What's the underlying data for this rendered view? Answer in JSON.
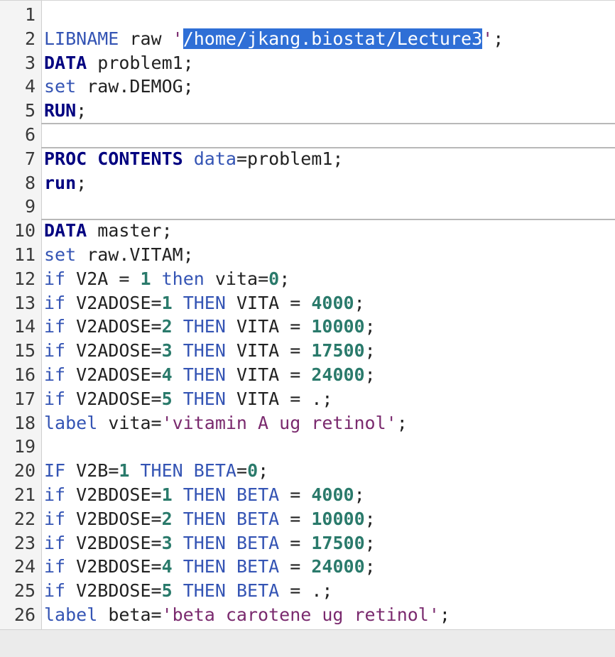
{
  "editor": {
    "selection_color": "#2f6fd6",
    "line_numbers": [
      "1",
      "2",
      "3",
      "4",
      "5",
      "6",
      "7",
      "8",
      "9",
      "10",
      "11",
      "12",
      "13",
      "14",
      "15",
      "16",
      "17",
      "18",
      "19",
      "20",
      "21",
      "22",
      "23",
      "24",
      "25",
      "26"
    ]
  },
  "code": [
    {
      "tokens": [],
      "sep": false
    },
    {
      "tokens": [
        {
          "t": "LIBNAME",
          "c": "st"
        },
        {
          "t": " raw ",
          "c": "txt"
        },
        {
          "t": "'",
          "c": "str"
        },
        {
          "t": "/home/jkang.biostat/Lecture3",
          "c": "sel"
        },
        {
          "t": "'",
          "c": "str"
        },
        {
          "t": ";",
          "c": "txt"
        }
      ],
      "sep": false
    },
    {
      "tokens": [
        {
          "t": "DATA",
          "c": "kw"
        },
        {
          "t": " problem1;",
          "c": "txt"
        }
      ],
      "sep": false
    },
    {
      "tokens": [
        {
          "t": "set",
          "c": "st"
        },
        {
          "t": " raw.DEMOG;",
          "c": "txt"
        }
      ],
      "sep": false
    },
    {
      "tokens": [
        {
          "t": "RUN",
          "c": "kw"
        },
        {
          "t": ";",
          "c": "txt"
        }
      ],
      "sep": false
    },
    {
      "tokens": [],
      "sep": true
    },
    {
      "tokens": [
        {
          "t": "PROC CONTENTS",
          "c": "kw"
        },
        {
          "t": " ",
          "c": "txt"
        },
        {
          "t": "data",
          "c": "st"
        },
        {
          "t": "=problem1;",
          "c": "txt"
        }
      ],
      "sep": true
    },
    {
      "tokens": [
        {
          "t": "run",
          "c": "kw"
        },
        {
          "t": ";",
          "c": "txt"
        }
      ],
      "sep": false
    },
    {
      "tokens": [],
      "sep": false
    },
    {
      "tokens": [
        {
          "t": "DATA",
          "c": "kw"
        },
        {
          "t": " master;",
          "c": "txt"
        }
      ],
      "sep": true
    },
    {
      "tokens": [
        {
          "t": "set",
          "c": "st"
        },
        {
          "t": " raw.VITAM;",
          "c": "txt"
        }
      ],
      "sep": false
    },
    {
      "tokens": [
        {
          "t": "if",
          "c": "st"
        },
        {
          "t": " V2A = ",
          "c": "txt"
        },
        {
          "t": "1",
          "c": "num"
        },
        {
          "t": " ",
          "c": "txt"
        },
        {
          "t": "then",
          "c": "st"
        },
        {
          "t": " vita=",
          "c": "txt"
        },
        {
          "t": "0",
          "c": "num"
        },
        {
          "t": ";",
          "c": "txt"
        }
      ],
      "sep": false
    },
    {
      "tokens": [
        {
          "t": "if",
          "c": "st"
        },
        {
          "t": " V2ADOSE=",
          "c": "txt"
        },
        {
          "t": "1",
          "c": "num"
        },
        {
          "t": " ",
          "c": "txt"
        },
        {
          "t": "THEN",
          "c": "st"
        },
        {
          "t": " VITA = ",
          "c": "txt"
        },
        {
          "t": "4000",
          "c": "num"
        },
        {
          "t": ";",
          "c": "txt"
        }
      ],
      "sep": false
    },
    {
      "tokens": [
        {
          "t": "if",
          "c": "st"
        },
        {
          "t": " V2ADOSE=",
          "c": "txt"
        },
        {
          "t": "2",
          "c": "num"
        },
        {
          "t": " ",
          "c": "txt"
        },
        {
          "t": "THEN",
          "c": "st"
        },
        {
          "t": " VITA = ",
          "c": "txt"
        },
        {
          "t": "10000",
          "c": "num"
        },
        {
          "t": ";",
          "c": "txt"
        }
      ],
      "sep": false
    },
    {
      "tokens": [
        {
          "t": "if",
          "c": "st"
        },
        {
          "t": " V2ADOSE=",
          "c": "txt"
        },
        {
          "t": "3",
          "c": "num"
        },
        {
          "t": " ",
          "c": "txt"
        },
        {
          "t": "THEN",
          "c": "st"
        },
        {
          "t": " VITA = ",
          "c": "txt"
        },
        {
          "t": "17500",
          "c": "num"
        },
        {
          "t": ";",
          "c": "txt"
        }
      ],
      "sep": false
    },
    {
      "tokens": [
        {
          "t": "if",
          "c": "st"
        },
        {
          "t": " V2ADOSE=",
          "c": "txt"
        },
        {
          "t": "4",
          "c": "num"
        },
        {
          "t": " ",
          "c": "txt"
        },
        {
          "t": "THEN",
          "c": "st"
        },
        {
          "t": " VITA = ",
          "c": "txt"
        },
        {
          "t": "24000",
          "c": "num"
        },
        {
          "t": ";",
          "c": "txt"
        }
      ],
      "sep": false
    },
    {
      "tokens": [
        {
          "t": "if",
          "c": "st"
        },
        {
          "t": " V2ADOSE=",
          "c": "txt"
        },
        {
          "t": "5",
          "c": "num"
        },
        {
          "t": " ",
          "c": "txt"
        },
        {
          "t": "THEN",
          "c": "st"
        },
        {
          "t": " VITA = .;",
          "c": "txt"
        }
      ],
      "sep": false
    },
    {
      "tokens": [
        {
          "t": "label",
          "c": "st"
        },
        {
          "t": " vita=",
          "c": "txt"
        },
        {
          "t": "'vitamin A ug retinol'",
          "c": "str"
        },
        {
          "t": ";",
          "c": "txt"
        }
      ],
      "sep": false
    },
    {
      "tokens": [],
      "sep": false
    },
    {
      "tokens": [
        {
          "t": "IF",
          "c": "st"
        },
        {
          "t": " V2B=",
          "c": "txt"
        },
        {
          "t": "1",
          "c": "num"
        },
        {
          "t": " ",
          "c": "txt"
        },
        {
          "t": "THEN",
          "c": "st"
        },
        {
          "t": " ",
          "c": "txt"
        },
        {
          "t": "BETA",
          "c": "st"
        },
        {
          "t": "=",
          "c": "txt"
        },
        {
          "t": "0",
          "c": "num"
        },
        {
          "t": ";",
          "c": "txt"
        }
      ],
      "sep": false
    },
    {
      "tokens": [
        {
          "t": "if",
          "c": "st"
        },
        {
          "t": " V2BDOSE=",
          "c": "txt"
        },
        {
          "t": "1",
          "c": "num"
        },
        {
          "t": " ",
          "c": "txt"
        },
        {
          "t": "THEN",
          "c": "st"
        },
        {
          "t": " ",
          "c": "txt"
        },
        {
          "t": "BETA",
          "c": "st"
        },
        {
          "t": " = ",
          "c": "txt"
        },
        {
          "t": "4000",
          "c": "num"
        },
        {
          "t": ";",
          "c": "txt"
        }
      ],
      "sep": false
    },
    {
      "tokens": [
        {
          "t": "if",
          "c": "st"
        },
        {
          "t": " V2BDOSE=",
          "c": "txt"
        },
        {
          "t": "2",
          "c": "num"
        },
        {
          "t": " ",
          "c": "txt"
        },
        {
          "t": "THEN",
          "c": "st"
        },
        {
          "t": " ",
          "c": "txt"
        },
        {
          "t": "BETA",
          "c": "st"
        },
        {
          "t": " = ",
          "c": "txt"
        },
        {
          "t": "10000",
          "c": "num"
        },
        {
          "t": ";",
          "c": "txt"
        }
      ],
      "sep": false
    },
    {
      "tokens": [
        {
          "t": "if",
          "c": "st"
        },
        {
          "t": " V2BDOSE=",
          "c": "txt"
        },
        {
          "t": "3",
          "c": "num"
        },
        {
          "t": " ",
          "c": "txt"
        },
        {
          "t": "THEN",
          "c": "st"
        },
        {
          "t": " ",
          "c": "txt"
        },
        {
          "t": "BETA",
          "c": "st"
        },
        {
          "t": " = ",
          "c": "txt"
        },
        {
          "t": "17500",
          "c": "num"
        },
        {
          "t": ";",
          "c": "txt"
        }
      ],
      "sep": false
    },
    {
      "tokens": [
        {
          "t": "if",
          "c": "st"
        },
        {
          "t": " V2BDOSE=",
          "c": "txt"
        },
        {
          "t": "4",
          "c": "num"
        },
        {
          "t": " ",
          "c": "txt"
        },
        {
          "t": "THEN",
          "c": "st"
        },
        {
          "t": " ",
          "c": "txt"
        },
        {
          "t": "BETA",
          "c": "st"
        },
        {
          "t": " = ",
          "c": "txt"
        },
        {
          "t": "24000",
          "c": "num"
        },
        {
          "t": ";",
          "c": "txt"
        }
      ],
      "sep": false
    },
    {
      "tokens": [
        {
          "t": "if",
          "c": "st"
        },
        {
          "t": " V2BDOSE=",
          "c": "txt"
        },
        {
          "t": "5",
          "c": "num"
        },
        {
          "t": " ",
          "c": "txt"
        },
        {
          "t": "THEN",
          "c": "st"
        },
        {
          "t": " ",
          "c": "txt"
        },
        {
          "t": "BETA",
          "c": "st"
        },
        {
          "t": " = .;",
          "c": "txt"
        }
      ],
      "sep": false
    },
    {
      "tokens": [
        {
          "t": "label",
          "c": "st"
        },
        {
          "t": " beta=",
          "c": "txt"
        },
        {
          "t": "'beta carotene ug retinol'",
          "c": "str"
        },
        {
          "t": ";",
          "c": "txt"
        }
      ],
      "sep": false
    }
  ]
}
